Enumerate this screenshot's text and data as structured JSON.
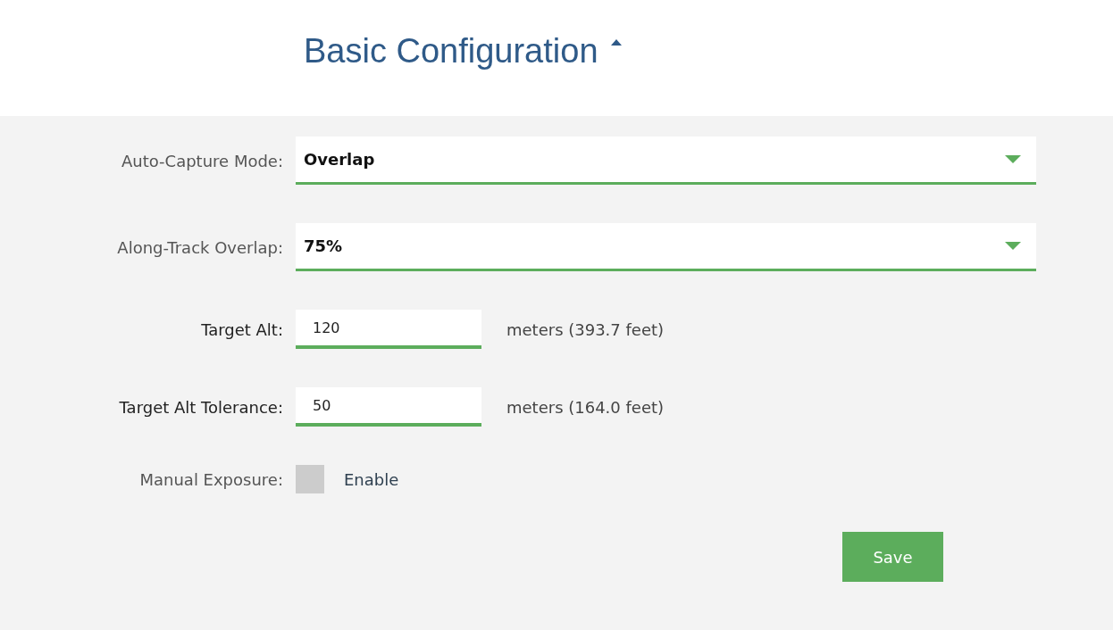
{
  "section": {
    "title": "Basic Configuration",
    "expanded": true
  },
  "fields": [
    {
      "kind": "select",
      "label": "Auto-Capture Mode:",
      "value": "Overlap"
    },
    {
      "kind": "select",
      "label": "Along-Track Overlap:",
      "value": "75%"
    },
    {
      "kind": "input",
      "label": "Target Alt:",
      "value": "120",
      "unit": "meters (393.7 feet)"
    },
    {
      "kind": "input",
      "label": "Target Alt Tolerance:",
      "value": "50",
      "unit": "meters (164.0 feet)"
    },
    {
      "kind": "checkbox",
      "label": "Manual Exposure:",
      "option": "Enable",
      "checked": false
    }
  ],
  "save_button": "Save"
}
